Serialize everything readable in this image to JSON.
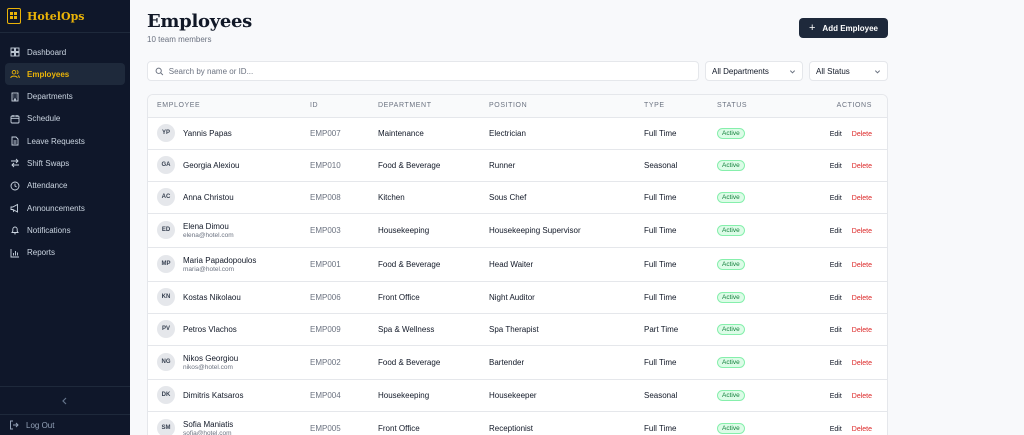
{
  "app": {
    "name": "HotelOps"
  },
  "sidebar": {
    "items": [
      {
        "label": "Dashboard",
        "icon": "grid-icon",
        "active": false
      },
      {
        "label": "Employees",
        "icon": "users-icon",
        "active": true
      },
      {
        "label": "Departments",
        "icon": "building-icon",
        "active": false
      },
      {
        "label": "Schedule",
        "icon": "calendar-icon",
        "active": false
      },
      {
        "label": "Leave Requests",
        "icon": "document-icon",
        "active": false
      },
      {
        "label": "Shift Swaps",
        "icon": "swap-icon",
        "active": false
      },
      {
        "label": "Attendance",
        "icon": "clock-icon",
        "active": false
      },
      {
        "label": "Announcements",
        "icon": "megaphone-icon",
        "active": false
      },
      {
        "label": "Notifications",
        "icon": "bell-icon",
        "active": false
      },
      {
        "label": "Reports",
        "icon": "bar-chart-icon",
        "active": false
      }
    ],
    "collapse_icon": "chevron-left-icon",
    "logout_label": "Log Out"
  },
  "header": {
    "title": "Employees",
    "subtitle": "10 team members",
    "add_button_label": "Add Employee"
  },
  "filters": {
    "search_placeholder": "Search by name or ID...",
    "department_value": "All Departments",
    "status_value": "All Status"
  },
  "table": {
    "columns": [
      "EMPLOYEE",
      "ID",
      "DEPARTMENT",
      "POSITION",
      "TYPE",
      "STATUS",
      "ACTIONS"
    ],
    "edit_label": "Edit",
    "delete_label": "Delete",
    "rows": [
      {
        "initials": "YP",
        "name": "Yannis Papas",
        "email": "",
        "id": "EMP007",
        "department": "Maintenance",
        "position": "Electrician",
        "type": "Full Time",
        "status": "Active"
      },
      {
        "initials": "GA",
        "name": "Georgia Alexiou",
        "email": "",
        "id": "EMP010",
        "department": "Food & Beverage",
        "position": "Runner",
        "type": "Seasonal",
        "status": "Active"
      },
      {
        "initials": "AC",
        "name": "Anna Christou",
        "email": "",
        "id": "EMP008",
        "department": "Kitchen",
        "position": "Sous Chef",
        "type": "Full Time",
        "status": "Active"
      },
      {
        "initials": "ED",
        "name": "Elena Dimou",
        "email": "elena@hotel.com",
        "id": "EMP003",
        "department": "Housekeeping",
        "position": "Housekeeping Supervisor",
        "type": "Full Time",
        "status": "Active"
      },
      {
        "initials": "MP",
        "name": "Maria Papadopoulos",
        "email": "maria@hotel.com",
        "id": "EMP001",
        "department": "Food & Beverage",
        "position": "Head Waiter",
        "type": "Full Time",
        "status": "Active"
      },
      {
        "initials": "KN",
        "name": "Kostas Nikolaou",
        "email": "",
        "id": "EMP006",
        "department": "Front Office",
        "position": "Night Auditor",
        "type": "Full Time",
        "status": "Active"
      },
      {
        "initials": "PV",
        "name": "Petros Vlachos",
        "email": "",
        "id": "EMP009",
        "department": "Spa & Wellness",
        "position": "Spa Therapist",
        "type": "Part Time",
        "status": "Active"
      },
      {
        "initials": "NG",
        "name": "Nikos Georgiou",
        "email": "nikos@hotel.com",
        "id": "EMP002",
        "department": "Food & Beverage",
        "position": "Bartender",
        "type": "Full Time",
        "status": "Active"
      },
      {
        "initials": "DK",
        "name": "Dimitris Katsaros",
        "email": "",
        "id": "EMP004",
        "department": "Housekeeping",
        "position": "Housekeeper",
        "type": "Seasonal",
        "status": "Active"
      },
      {
        "initials": "SM",
        "name": "Sofia Maniatis",
        "email": "sofia@hotel.com",
        "id": "EMP005",
        "department": "Front Office",
        "position": "Receptionist",
        "type": "Full Time",
        "status": "Active"
      }
    ]
  },
  "colors": {
    "sidebar_bg": "#0f172a",
    "accent": "#eab308",
    "primary_button": "#1e293b",
    "delete": "#dc2626",
    "active_badge": "#15803d"
  }
}
